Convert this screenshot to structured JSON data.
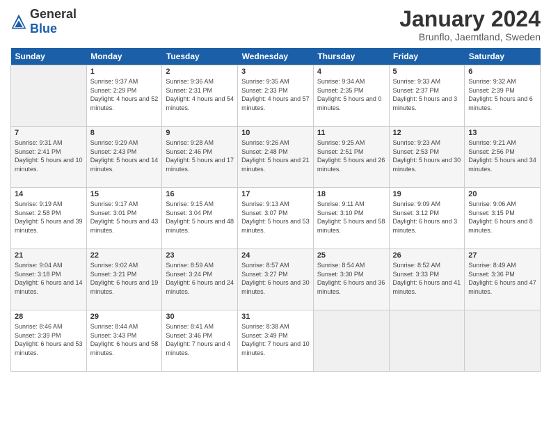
{
  "header": {
    "logo_general": "General",
    "logo_blue": "Blue",
    "month_title": "January 2024",
    "location": "Brunflo, Jaemtland, Sweden"
  },
  "days_of_week": [
    "Sunday",
    "Monday",
    "Tuesday",
    "Wednesday",
    "Thursday",
    "Friday",
    "Saturday"
  ],
  "weeks": [
    [
      {
        "day": "",
        "sunrise": "",
        "sunset": "",
        "daylight": "",
        "empty": true
      },
      {
        "day": "1",
        "sunrise": "Sunrise: 9:37 AM",
        "sunset": "Sunset: 2:29 PM",
        "daylight": "Daylight: 4 hours and 52 minutes."
      },
      {
        "day": "2",
        "sunrise": "Sunrise: 9:36 AM",
        "sunset": "Sunset: 2:31 PM",
        "daylight": "Daylight: 4 hours and 54 minutes."
      },
      {
        "day": "3",
        "sunrise": "Sunrise: 9:35 AM",
        "sunset": "Sunset: 2:33 PM",
        "daylight": "Daylight: 4 hours and 57 minutes."
      },
      {
        "day": "4",
        "sunrise": "Sunrise: 9:34 AM",
        "sunset": "Sunset: 2:35 PM",
        "daylight": "Daylight: 5 hours and 0 minutes."
      },
      {
        "day": "5",
        "sunrise": "Sunrise: 9:33 AM",
        "sunset": "Sunset: 2:37 PM",
        "daylight": "Daylight: 5 hours and 3 minutes."
      },
      {
        "day": "6",
        "sunrise": "Sunrise: 9:32 AM",
        "sunset": "Sunset: 2:39 PM",
        "daylight": "Daylight: 5 hours and 6 minutes."
      }
    ],
    [
      {
        "day": "7",
        "sunrise": "Sunrise: 9:31 AM",
        "sunset": "Sunset: 2:41 PM",
        "daylight": "Daylight: 5 hours and 10 minutes."
      },
      {
        "day": "8",
        "sunrise": "Sunrise: 9:29 AM",
        "sunset": "Sunset: 2:43 PM",
        "daylight": "Daylight: 5 hours and 14 minutes."
      },
      {
        "day": "9",
        "sunrise": "Sunrise: 9:28 AM",
        "sunset": "Sunset: 2:46 PM",
        "daylight": "Daylight: 5 hours and 17 minutes."
      },
      {
        "day": "10",
        "sunrise": "Sunrise: 9:26 AM",
        "sunset": "Sunset: 2:48 PM",
        "daylight": "Daylight: 5 hours and 21 minutes."
      },
      {
        "day": "11",
        "sunrise": "Sunrise: 9:25 AM",
        "sunset": "Sunset: 2:51 PM",
        "daylight": "Daylight: 5 hours and 26 minutes."
      },
      {
        "day": "12",
        "sunrise": "Sunrise: 9:23 AM",
        "sunset": "Sunset: 2:53 PM",
        "daylight": "Daylight: 5 hours and 30 minutes."
      },
      {
        "day": "13",
        "sunrise": "Sunrise: 9:21 AM",
        "sunset": "Sunset: 2:56 PM",
        "daylight": "Daylight: 5 hours and 34 minutes."
      }
    ],
    [
      {
        "day": "14",
        "sunrise": "Sunrise: 9:19 AM",
        "sunset": "Sunset: 2:58 PM",
        "daylight": "Daylight: 5 hours and 39 minutes."
      },
      {
        "day": "15",
        "sunrise": "Sunrise: 9:17 AM",
        "sunset": "Sunset: 3:01 PM",
        "daylight": "Daylight: 5 hours and 43 minutes."
      },
      {
        "day": "16",
        "sunrise": "Sunrise: 9:15 AM",
        "sunset": "Sunset: 3:04 PM",
        "daylight": "Daylight: 5 hours and 48 minutes."
      },
      {
        "day": "17",
        "sunrise": "Sunrise: 9:13 AM",
        "sunset": "Sunset: 3:07 PM",
        "daylight": "Daylight: 5 hours and 53 minutes."
      },
      {
        "day": "18",
        "sunrise": "Sunrise: 9:11 AM",
        "sunset": "Sunset: 3:10 PM",
        "daylight": "Daylight: 5 hours and 58 minutes."
      },
      {
        "day": "19",
        "sunrise": "Sunrise: 9:09 AM",
        "sunset": "Sunset: 3:12 PM",
        "daylight": "Daylight: 6 hours and 3 minutes."
      },
      {
        "day": "20",
        "sunrise": "Sunrise: 9:06 AM",
        "sunset": "Sunset: 3:15 PM",
        "daylight": "Daylight: 6 hours and 8 minutes."
      }
    ],
    [
      {
        "day": "21",
        "sunrise": "Sunrise: 9:04 AM",
        "sunset": "Sunset: 3:18 PM",
        "daylight": "Daylight: 6 hours and 14 minutes."
      },
      {
        "day": "22",
        "sunrise": "Sunrise: 9:02 AM",
        "sunset": "Sunset: 3:21 PM",
        "daylight": "Daylight: 6 hours and 19 minutes."
      },
      {
        "day": "23",
        "sunrise": "Sunrise: 8:59 AM",
        "sunset": "Sunset: 3:24 PM",
        "daylight": "Daylight: 6 hours and 24 minutes."
      },
      {
        "day": "24",
        "sunrise": "Sunrise: 8:57 AM",
        "sunset": "Sunset: 3:27 PM",
        "daylight": "Daylight: 6 hours and 30 minutes."
      },
      {
        "day": "25",
        "sunrise": "Sunrise: 8:54 AM",
        "sunset": "Sunset: 3:30 PM",
        "daylight": "Daylight: 6 hours and 36 minutes."
      },
      {
        "day": "26",
        "sunrise": "Sunrise: 8:52 AM",
        "sunset": "Sunset: 3:33 PM",
        "daylight": "Daylight: 6 hours and 41 minutes."
      },
      {
        "day": "27",
        "sunrise": "Sunrise: 8:49 AM",
        "sunset": "Sunset: 3:36 PM",
        "daylight": "Daylight: 6 hours and 47 minutes."
      }
    ],
    [
      {
        "day": "28",
        "sunrise": "Sunrise: 8:46 AM",
        "sunset": "Sunset: 3:39 PM",
        "daylight": "Daylight: 6 hours and 53 minutes."
      },
      {
        "day": "29",
        "sunrise": "Sunrise: 8:44 AM",
        "sunset": "Sunset: 3:43 PM",
        "daylight": "Daylight: 6 hours and 58 minutes."
      },
      {
        "day": "30",
        "sunrise": "Sunrise: 8:41 AM",
        "sunset": "Sunset: 3:46 PM",
        "daylight": "Daylight: 7 hours and 4 minutes."
      },
      {
        "day": "31",
        "sunrise": "Sunrise: 8:38 AM",
        "sunset": "Sunset: 3:49 PM",
        "daylight": "Daylight: 7 hours and 10 minutes."
      },
      {
        "day": "",
        "sunrise": "",
        "sunset": "",
        "daylight": "",
        "empty": true
      },
      {
        "day": "",
        "sunrise": "",
        "sunset": "",
        "daylight": "",
        "empty": true
      },
      {
        "day": "",
        "sunrise": "",
        "sunset": "",
        "daylight": "",
        "empty": true
      }
    ]
  ]
}
